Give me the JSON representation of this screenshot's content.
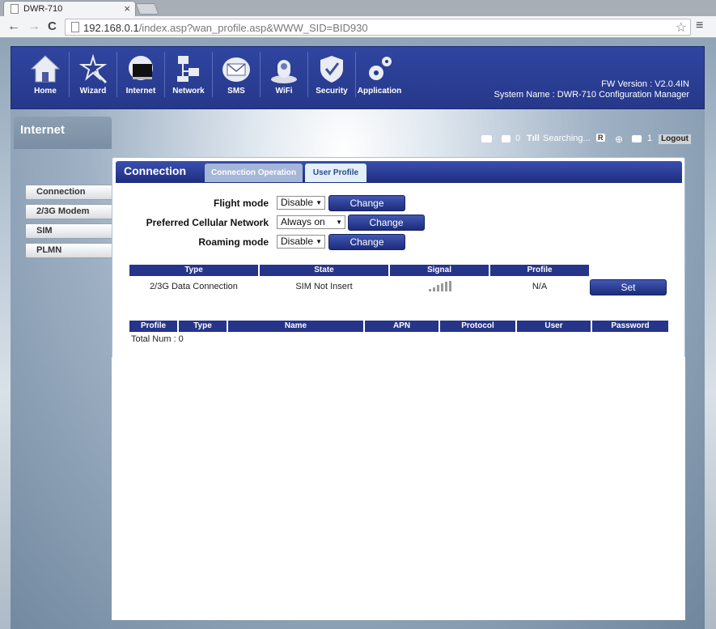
{
  "browser": {
    "tab_title": "DWR-710",
    "tab_close": "×",
    "url_host": "192.168.0.1",
    "url_rest": "/index.asp?wan_profile.asp&WWW_SID=BID930",
    "back": "←",
    "forward": "→",
    "reload": "C",
    "star": "☆",
    "menu": "≡"
  },
  "header": {
    "nav": [
      {
        "label": "Home"
      },
      {
        "label": "Wizard"
      },
      {
        "label": "Internet"
      },
      {
        "label": "Network"
      },
      {
        "label": "SMS"
      },
      {
        "label": "WiFi"
      },
      {
        "label": "Security"
      },
      {
        "label": "Application"
      }
    ],
    "fw_version": "FW Version : V2.0.4IN",
    "system_name": "System Name : DWR-710 Configuration Manager"
  },
  "section_title": "Internet",
  "status": {
    "sms_count": "0",
    "signal_text": "Searching...",
    "roaming": "R",
    "clients": "1",
    "logout": "Logout"
  },
  "sidebar": {
    "items": [
      {
        "label": "Connection"
      },
      {
        "label": "2/3G Modem"
      },
      {
        "label": "SIM"
      },
      {
        "label": "PLMN"
      }
    ]
  },
  "main": {
    "title": "Connection",
    "tabs": [
      {
        "label": "Connection Operation"
      },
      {
        "label": "User Profile"
      }
    ],
    "form": {
      "flight_mode": {
        "label": "Flight mode",
        "value": "Disable",
        "button": "Change"
      },
      "preferred_network": {
        "label": "Preferred Cellular Network",
        "value": "Always on",
        "button": "Change"
      },
      "roaming_mode": {
        "label": "Roaming mode",
        "value": "Disable",
        "button": "Change"
      }
    },
    "status_table": {
      "headers": [
        "Type",
        "State",
        "Signal",
        "Profile"
      ],
      "row": {
        "type": "2/3G Data Connection",
        "state": "SIM Not Insert",
        "profile": "N/A"
      },
      "set_button": "Set"
    },
    "profile_table": {
      "headers": [
        "Profile",
        "Type",
        "Name",
        "APN",
        "Protocol",
        "User",
        "Password"
      ],
      "total": "Total Num : 0"
    }
  }
}
